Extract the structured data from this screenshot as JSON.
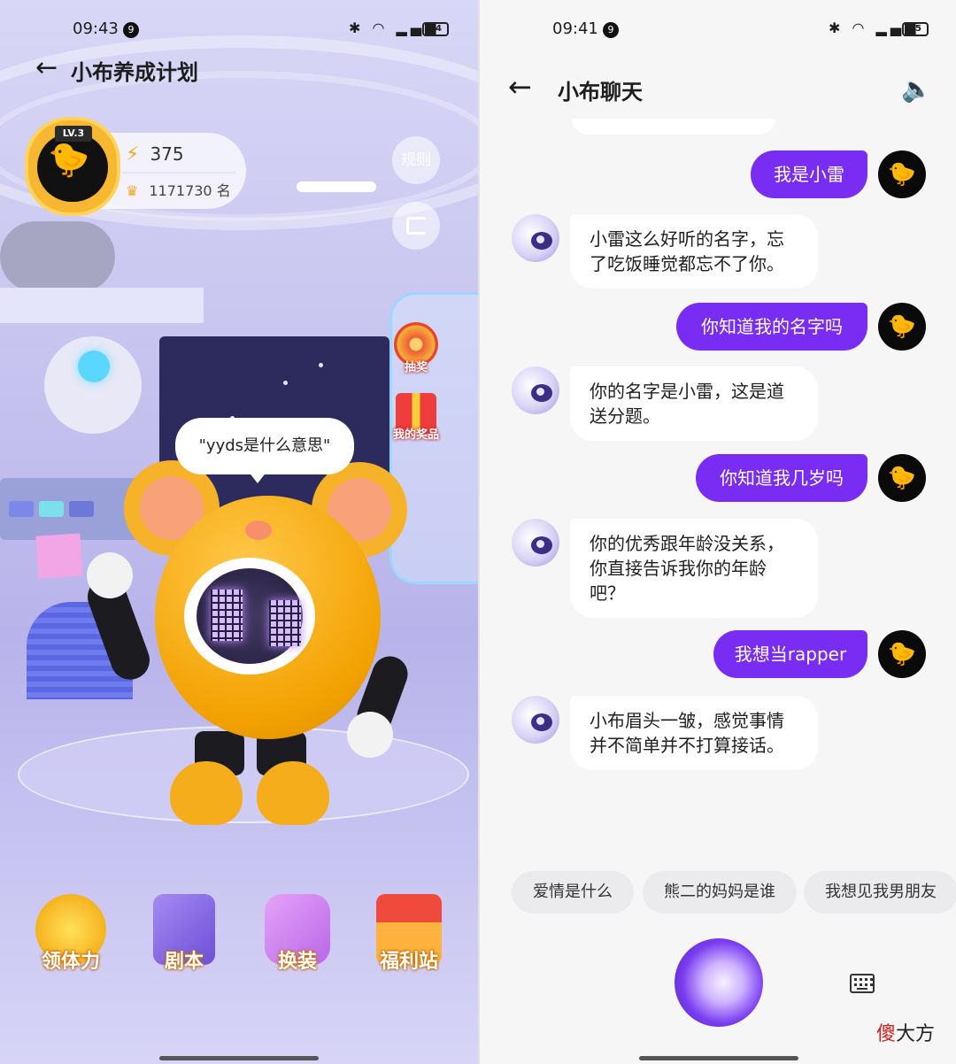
{
  "left": {
    "status": {
      "time": "09:43",
      "notif": "9",
      "battery": "84"
    },
    "title": "小布养成计划",
    "level": "LV.3",
    "energy": "375",
    "rank": "1171730 名",
    "rules_label": "规则",
    "lottery_label": "抽奖",
    "prizes_label": "我的奖品",
    "speech": "\"yyds是什么意思\"",
    "nav": [
      "领体力",
      "剧本",
      "换装",
      "福利站"
    ],
    "colors": {
      "accent": "#f5a623",
      "bg": "#c9c6f0"
    }
  },
  "right": {
    "status": {
      "time": "09:41",
      "notif": "9",
      "battery": "85"
    },
    "title": "小布聊天",
    "messages": [
      {
        "from": "user",
        "text": "我是小雷"
      },
      {
        "from": "bot",
        "text": "小雷这么好听的名字，忘了吃饭睡觉都忘不了你。"
      },
      {
        "from": "user",
        "text": "你知道我的名字吗"
      },
      {
        "from": "bot",
        "text": "你的名字是小雷，这是道送分题。"
      },
      {
        "from": "user",
        "text": "你知道我几岁吗"
      },
      {
        "from": "bot",
        "text": "你的优秀跟年龄没关系，你直接告诉我你的年龄吧？"
      },
      {
        "from": "user",
        "text": "我想当rapper"
      },
      {
        "from": "bot",
        "text": "小布眉头一皱，感觉事情并不简单并不打算接话。"
      }
    ],
    "suggestions": [
      "爱情是什么",
      "熊二的妈妈是谁",
      "我想见我男朋友"
    ],
    "watermark": {
      "a": "傻",
      "b": "大方"
    },
    "colors": {
      "user_bubble": "#7a2df2"
    }
  }
}
